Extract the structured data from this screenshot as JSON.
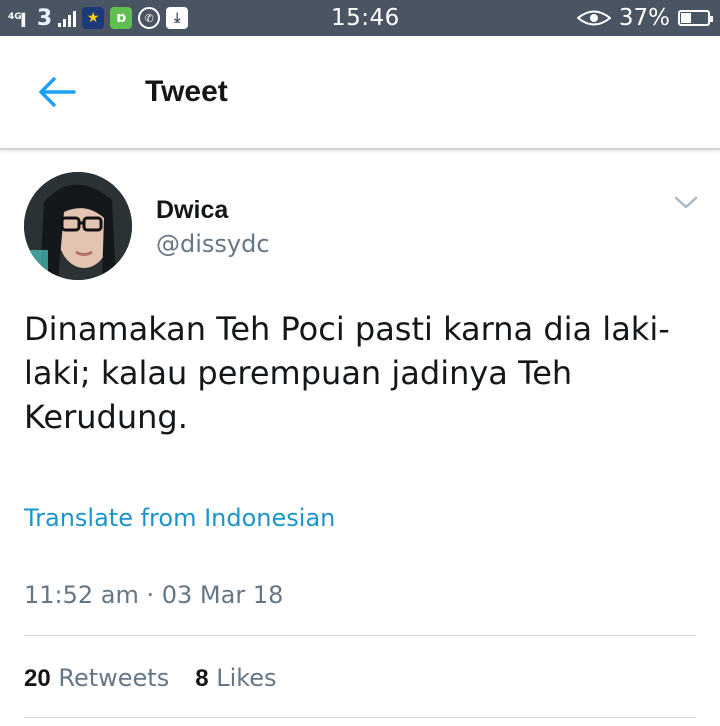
{
  "status_bar": {
    "network": "4G",
    "carrier_logo": "3",
    "time": "15:46",
    "battery": "37%",
    "battery_level": 0.37,
    "icons": [
      "signal-icon",
      "carrier-3-icon",
      "signal-bars-icon",
      "star-app-icon",
      "chat-app-icon",
      "whatsapp-icon",
      "download-icon",
      "eye-icon",
      "battery-icon"
    ]
  },
  "header": {
    "title": "Tweet",
    "back_icon": "arrow-left-icon",
    "accent": "#1da1f2"
  },
  "tweet": {
    "name": "Dwica",
    "handle": "@dissydc",
    "text": "Dinamakan Teh Poci pasti karna dia laki-laki; kalau perempuan jadinya Teh Kerudung.",
    "translate_label": "Translate from Indonesian",
    "timestamp": "11:52 am · 03 Mar 18",
    "retweets_count": "20",
    "retweets_label": "Retweets",
    "likes_count": "8",
    "likes_label": "Likes"
  },
  "colors": {
    "status_bar": "#4a5563",
    "link": "#1b95c9",
    "secondary_text": "#657786"
  }
}
